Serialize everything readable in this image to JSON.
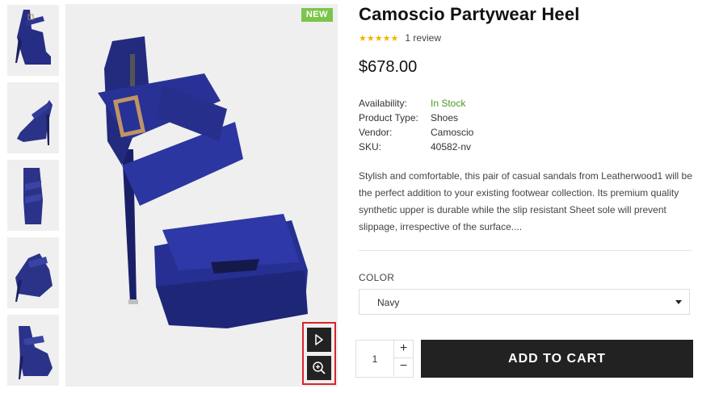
{
  "product": {
    "title": "Camoscio Partywear Heel",
    "rating_stars": "★★★★★",
    "review_count": "1 review",
    "price": "$678.00",
    "badge": "NEW",
    "meta": {
      "availability_label": "Availability:",
      "availability_value": "In Stock",
      "type_label": "Product Type:",
      "type_value": "Shoes",
      "vendor_label": "Vendor:",
      "vendor_value": "Camoscio",
      "sku_label": "SKU:",
      "sku_value": "40582-nv"
    },
    "description": "Stylish and comfortable, this pair of casual sandals from Leatherwood1 will be the perfect addition to your existing footwear collection. Its premium quality synthetic upper is durable while the slip resistant Sheet sole will prevent slippage, irrespective of the surface....",
    "color_label": "COLOR",
    "color_selected": "Navy",
    "quantity": "1",
    "qty_plus": "+",
    "qty_minus": "−",
    "add_to_cart": "ADD TO CART"
  },
  "icons": {
    "play": "play-icon",
    "zoom": "zoom-in-icon",
    "caret": "caret-down-icon",
    "star": "star-icon"
  },
  "colors": {
    "accent_badge": "#7cc54a",
    "stock_green": "#4a9a1e",
    "star_gold": "#f5b301",
    "dark_button": "#222222",
    "highlight_border": "#d9232d",
    "shoe_navy": "#27308a"
  }
}
